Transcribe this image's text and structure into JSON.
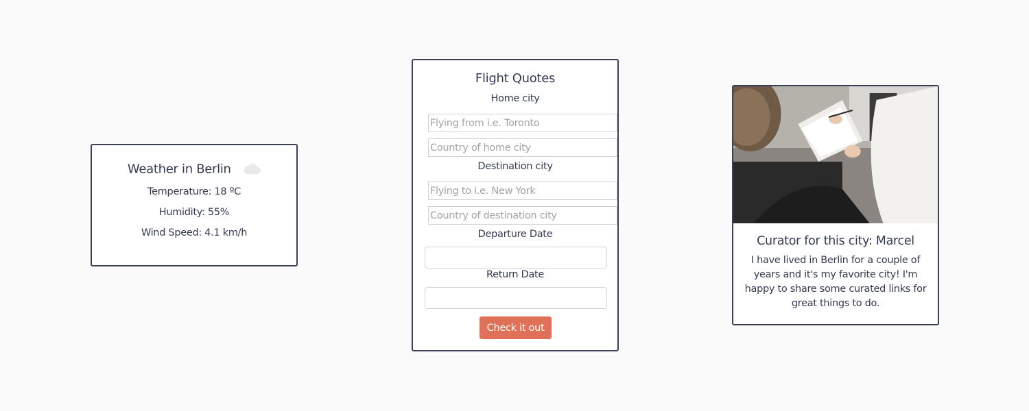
{
  "weather": {
    "title": "Weather in Berlin",
    "icon": "cloud-icon",
    "temperature": "Temperature: 18 ºC",
    "humidity": "Humidity: 55%",
    "wind": "Wind Speed: 4.1 km/h"
  },
  "flight": {
    "title": "Flight Quotes",
    "home_label": "Home city",
    "home_city_placeholder": "Flying from i.e. Toronto",
    "home_country_placeholder": "Country of home city",
    "dest_label": "Destination city",
    "dest_city_placeholder": "Flying to i.e. New York",
    "dest_country_placeholder": "Country of destination city",
    "departure_label": "Departure Date",
    "return_label": "Return Date",
    "submit_label": "Check it out",
    "accent": "#e07057"
  },
  "curator": {
    "title": "Curator for this city: Marcel",
    "bio": "I have lived in Berlin for a couple of years and it's my favorite city! I'm happy to share some curated links for great things to do."
  }
}
